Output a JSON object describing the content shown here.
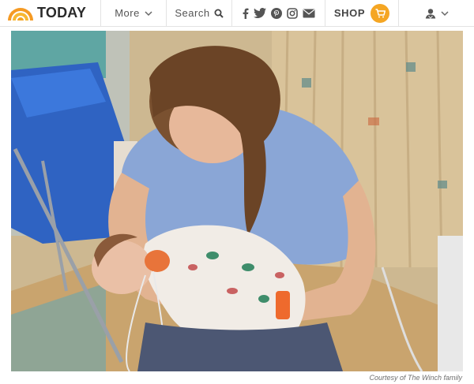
{
  "header": {
    "logo_text": "TODAY",
    "more_label": "More",
    "search_label": "Search",
    "shop_label": "SHOP",
    "social_icons": [
      "facebook-icon",
      "twitter-icon",
      "pinterest-icon",
      "instagram-icon",
      "email-icon"
    ]
  },
  "photo": {
    "credit": "Courtesy of The Winch family"
  },
  "colors": {
    "brand_orange": "#f5a623",
    "text_gray": "#555555"
  }
}
